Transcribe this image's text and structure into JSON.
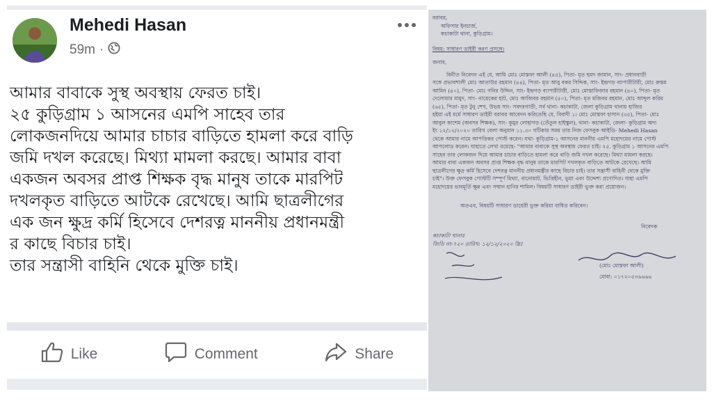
{
  "post": {
    "author": "Mehedi Hasan",
    "time": "59m",
    "more_icon": "ellipsis-icon",
    "privacy_icon": "globe-icon",
    "body_lines": [
      "আমার বাবাকে সুস্থ অবস্থায় ফেরত চাই।",
      " ২৫ কুড়িগ্রাম ১ আসনের এমপি সাহেব তার",
      "লোকজনদিয়ে আমার চাচার বাড়িতে হামলা করে বাড়ি",
      "জমি দখল করেছে। মিথ্যা মামলা করছে। আমার বাবা",
      "একজন অবসর প্রাপ্ত শিক্ষক বৃদ্ধ মানুষ তাকে মারপিট",
      "দখলকৃত  বাড়িতে আটকে রেখেছে। আমি ছাত্রলীগের",
      "এক জন ক্ষুদ্র কর্মি হিসেবে দেশরত্ন মাননীয় প্রধানমন্ত্রী",
      "র কাছে বিচার চাই।",
      "তার সন্ত্রাসী বাহিনি থেকে মুক্তি চাই।"
    ],
    "actions": {
      "like": "Like",
      "comment": "Comment",
      "share": "Share"
    }
  },
  "document": {
    "lines": [
      "বরাবর,",
      "অফিসার ইনচার্জ,",
      "কচাকাটা থানা, কুড়িগ্রাম।",
      "বিষয়: সাধারণ ডাইরী করণ প্রসঙ্গে।",
      "জনাব,",
      "বিনীত নিবেদন এই যে, আমি মোঃ মোস্তফা আলী (৪৫), পিতা- মৃত ছমদ জামান, সাং- প্রধানবাড়ী",
      "সঙ্গে প্রভাবশালী মোঃ আতাউর রহমান (৪৪), পিতা- মৃত আবু বকর সিদ্দিক, সাং- ইন্দ্রগড় ব্যাপারীটারী, মোঃ রুস্তম",
      "আমিন (৪০), পিতা- মোঃ গনির উদ্দিন, সাং- ইন্দ্রগড় ব্যাপারীটারী, মোঃ মোস্তাফিজার রহমান (৪০), পিতা- মৃত",
      "দেলোয়ার মামুদ, সাং- নায়েকের হাট, মোঃ আজিবর রহমান (৫০), পিতা- মৃত মজিবর রহমান, মোঃ আব্দুল করিম",
      "(৬৫), পিতা- মৃত টুনু শেখ, উভয় সাং- সবদরগাতী, সর্ব থানা- কচাকাটা, জেলা কুড়িগ্রাম থানায় হাজির",
      "হইয়া এই মর্মে সাধারণ ডাইরী বরাবর আবেদন করিতেছি যে, বিবাদী ১। মোঃ মোস্তফা হাসান (৩৫), পিতা- মোঃ",
      "আবুল কাশেম (অবসর শিক্ষক), সাং- কুমুর লোহাগড় (তেঁতুল হাইস্কুল), থানা- কচাকাটা, জেলা- কুড়িগ্রাম অদ্য",
      "ইং ১২/১২/২০২০ তারিখ বেলা অনুমান ১১.৩০ ঘটিকার সময় তার নিজ ফেসবুক আইডি- Mehedi Hasan",
      "থেকে আমার নামে আপত্তিকর পোস্ট করেন। যথা- কুড়িগ্রাম-১ আসনের মাননীয় এমপি মহোদয়ের নামে পোস্ট",
      "আপলোড করেন। যাহাতে লেখা রয়েছে- \"আমার বাবাকে সুস্থ অবস্থায় ফেরত চাই। ২৫. কুড়িগ্রাম ১ আসনের এমপি",
      "সাহেব তার লোকজন দিয়ে আমার চাচার বাড়িতে হামলা করে বাড়ি জমি দখল করেছে। মিথ্যা মামলা করছে।",
      "আমার বাবা একজন অবসর প্রাপ্ত শিক্ষক বৃদ্ধ মানুষ তাকে মারপিট দখলকৃত বাড়িতে আটকে রেখেছে। আমি",
      "ছাত্রলীগের ক্ষুদ্র কর্মি হিসেবে দেশরত্ন মাননীয় প্রধানমন্ত্রীর কাছে বিচার চাই। তার সন্ত্রাসী বাহিনী থেকে মুক্তি",
      "চাই\"। উক্ত ফেসবুক পোস্টটি সম্পূর্ণ মিথ্যা, বানোয়াট, ভিত্তিহীন, ভুয়া এবং উদ্দেশ্য প্রণোদিত। যাহা এমপি",
      "মহোদয়ের ভাবমূর্তি ক্ষুন্ন এবং সম্মান হানির শামিল। বিষয়টি সাধারণ ডাইরী ভুক্ত করা প্রয়োজন।",
      "অতএব, বিষয়টি সাধারণ ডায়েরী ভুক্ত করিয়া বাধিত করিবেন।",
      "নিবেদক",
      "কচাকাটা থানার",
      "জিডি নং-৭২০ তারিখ: ১২/১২/২০২০ খ্রিঃ",
      "(মোঃ মোস্তফা আলী)",
      "মোবা: ০১৭২০৫৩৬৬৬৬"
    ]
  }
}
